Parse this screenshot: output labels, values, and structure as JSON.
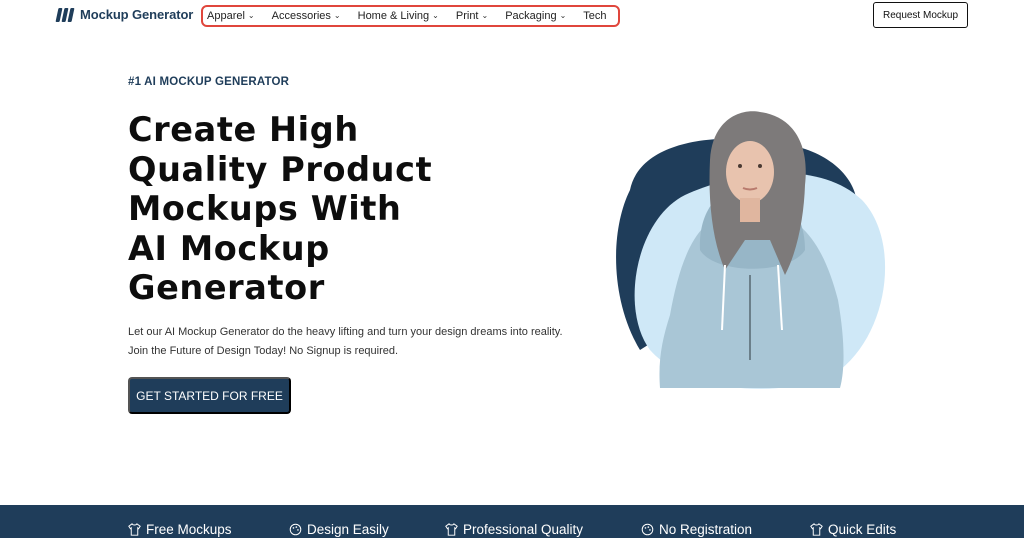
{
  "brand": {
    "name": "Mockup Generator"
  },
  "nav": {
    "items": [
      {
        "label": "Apparel",
        "has_dropdown": true
      },
      {
        "label": "Accessories",
        "has_dropdown": true
      },
      {
        "label": "Home & Living",
        "has_dropdown": true
      },
      {
        "label": "Print",
        "has_dropdown": true
      },
      {
        "label": "Packaging",
        "has_dropdown": true
      },
      {
        "label": "Tech",
        "has_dropdown": false
      }
    ],
    "chevron": "⌄"
  },
  "header": {
    "request_button": "Request Mockup"
  },
  "hero": {
    "eyebrow": "#1 AI MOCKUP GENERATOR",
    "title_lines": [
      "Create High",
      "Quality Product",
      "Mockups With",
      "AI Mockup",
      "Generator"
    ],
    "description_lines": [
      "Let our AI Mockup Generator do the heavy lifting and turn your design dreams into reality.",
      "Join the Future of Design Today! No Signup is required."
    ],
    "cta": "GET STARTED FOR FREE"
  },
  "features": [
    {
      "label": "Free Mockups",
      "icon": "tshirt-icon"
    },
    {
      "label": "Design Easily",
      "icon": "palette-icon"
    },
    {
      "label": "Professional Quality",
      "icon": "tshirt-icon"
    },
    {
      "label": "No Registration",
      "icon": "palette-icon"
    },
    {
      "label": "Quick Edits",
      "icon": "tshirt-icon"
    }
  ],
  "colors": {
    "brand_navy": "#1f3d5a",
    "blob_dark": "#1f3d5a",
    "blob_light": "#cfe8f7",
    "nav_highlight": "#e0463c",
    "hoodie": "#a9c6d6"
  }
}
